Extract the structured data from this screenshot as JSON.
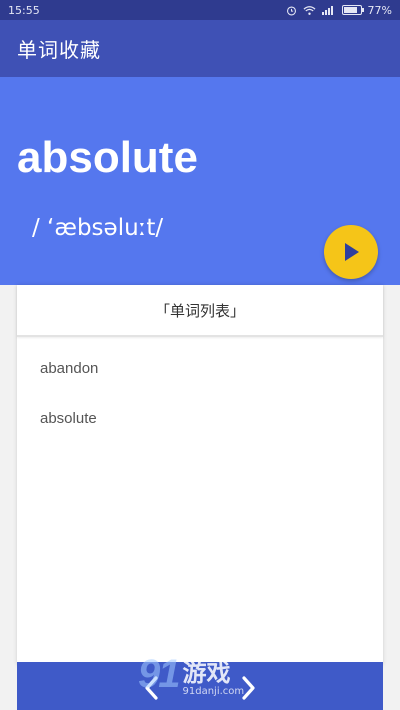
{
  "status_bar": {
    "time": "15:55",
    "battery_percent": "77%",
    "icons": [
      "alarm-icon",
      "wifi-icon",
      "signal-icon",
      "battery-icon"
    ]
  },
  "app_bar": {
    "title": "单词收藏"
  },
  "hero": {
    "word": "absolute",
    "phonetic": "/ ‘æbsəluːt/",
    "background_color": "#5577ee",
    "play_button_color": "#f5c518",
    "play_icon": "play-icon"
  },
  "word_list": {
    "header": "「单词列表」",
    "items": [
      "abandon",
      "absolute"
    ]
  },
  "bottom_bar": {
    "prev_icon": "chevron-left-icon",
    "next_icon": "chevron-right-icon",
    "color": "#3f5ac8"
  },
  "watermark": {
    "logo": "91",
    "brand": "游戏",
    "url": "91danji.com"
  }
}
